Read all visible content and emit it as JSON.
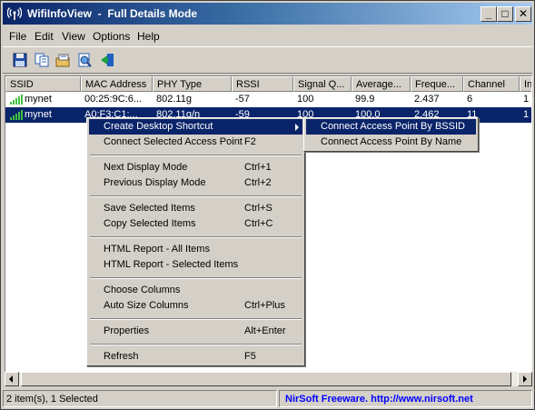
{
  "window": {
    "title": "WifiInfoView  -  Full Details Mode"
  },
  "title_buttons": {
    "minimize": "_",
    "maximize": "□",
    "close": "✕"
  },
  "menubar": {
    "file": "File",
    "edit": "Edit",
    "view": "View",
    "options": "Options",
    "help": "Help"
  },
  "toolbar": {
    "icons": [
      "save-icon",
      "copy-icon",
      "properties-icon",
      "html-report-icon",
      "exit-icon"
    ]
  },
  "columns": [
    "SSID",
    "MAC Address",
    "PHY Type",
    "RSSI",
    "Signal Q...",
    "Average...",
    "Freque...",
    "Channel",
    "In"
  ],
  "rows": [
    {
      "ssid": "mynet",
      "mac": "00:25:9C:6...",
      "phy": "802.11g",
      "rssi": "-57",
      "signal": "100",
      "average": "99.9",
      "freq": "2.437",
      "channel": "6",
      "extra": "1"
    },
    {
      "ssid": "mynet",
      "mac": "A0:F3:C1:...",
      "phy": "802.11g/n",
      "rssi": "-59",
      "signal": "100",
      "average": "100.0",
      "freq": "2.462",
      "channel": "11",
      "extra": "1"
    }
  ],
  "context_menu": {
    "items": [
      {
        "label": "Create Desktop Shortcut",
        "shortcut": ""
      },
      {
        "label": "Connect Selected Access Point",
        "shortcut": "F2"
      },
      {
        "label": "Next Display Mode",
        "shortcut": "Ctrl+1"
      },
      {
        "label": "Previous Display Mode",
        "shortcut": "Ctrl+2"
      },
      {
        "label": "Save Selected Items",
        "shortcut": "Ctrl+S"
      },
      {
        "label": "Copy Selected Items",
        "shortcut": "Ctrl+C"
      },
      {
        "label": "HTML Report - All Items",
        "shortcut": ""
      },
      {
        "label": "HTML Report - Selected Items",
        "shortcut": ""
      },
      {
        "label": "Choose Columns",
        "shortcut": ""
      },
      {
        "label": "Auto Size Columns",
        "shortcut": "Ctrl+Plus"
      },
      {
        "label": "Properties",
        "shortcut": "Alt+Enter"
      },
      {
        "label": "Refresh",
        "shortcut": "F5"
      }
    ]
  },
  "submenu": {
    "items": [
      {
        "label": "Connect Access Point By BSSID"
      },
      {
        "label": "Connect Access Point By Name"
      }
    ]
  },
  "statusbar": {
    "count": "2 item(s), 1 Selected",
    "link": "NirSoft Freeware.  http://www.nirsoft.net"
  },
  "colors": {
    "selection": "#0a246a",
    "link": "#0000ff",
    "face": "#d4d0c8"
  }
}
